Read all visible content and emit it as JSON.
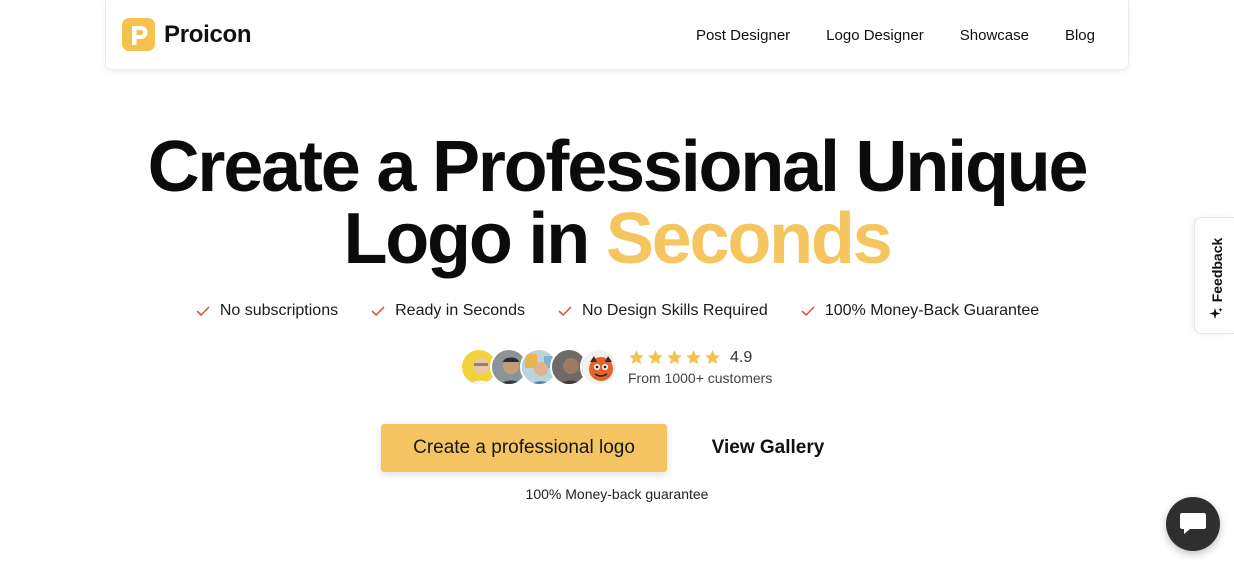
{
  "header": {
    "brand": {
      "name": "Proicon",
      "icon": "p-logo-icon",
      "color": "#F5C24F"
    },
    "nav": [
      {
        "label": "Post Designer"
      },
      {
        "label": "Logo Designer"
      },
      {
        "label": "Showcase"
      },
      {
        "label": "Blog"
      }
    ]
  },
  "hero": {
    "title_line1": "Create a Professional Unique",
    "title_line2_start": "Logo in ",
    "title_line2_accent": "Seconds",
    "accent_color": "#F5C65F",
    "features": [
      {
        "label": "No subscriptions",
        "icon": "check-icon"
      },
      {
        "label": "Ready in Seconds",
        "icon": "check-icon"
      },
      {
        "label": "No Design Skills Required",
        "icon": "check-icon"
      },
      {
        "label": "100% Money-Back Guarantee",
        "icon": "check-icon"
      }
    ],
    "check_color": "#D9573A"
  },
  "social_proof": {
    "avatar_count": 5,
    "stars": 5,
    "star_color": "#F5C24F",
    "rating": "4.9",
    "customers_text": "From 1000+ customers"
  },
  "cta": {
    "primary_label": "Create a professional logo",
    "primary_color": "#F5C462",
    "secondary_label": "View Gallery",
    "guarantee_text": "100% Money-back guarantee"
  },
  "feedback": {
    "label": "Feedback",
    "icon": "sparkle-icon"
  },
  "chat": {
    "icon": "chat-bubble-icon",
    "color": "#2F2F2F"
  }
}
